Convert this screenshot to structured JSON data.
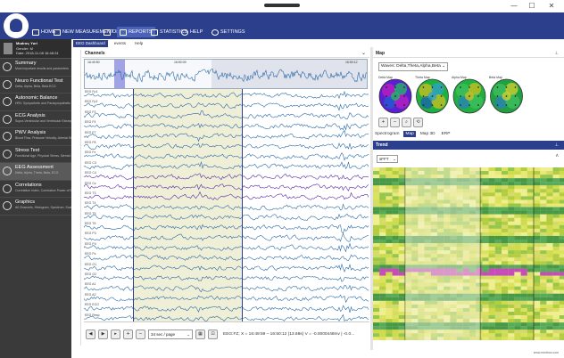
{
  "window": {
    "minimize": "—",
    "maximize": "☐",
    "close": "✕"
  },
  "nav": {
    "home": "HOME",
    "new_measurement": "NEW MEASUREMENT",
    "open": "OPEN",
    "reports": "REPORTS",
    "statistics": "STATISTICS",
    "help": "HELP",
    "settings": "SETTINGS"
  },
  "patient": {
    "name": "Mudrov, Yuri",
    "gender": "Gender: M",
    "age": "Age: 30",
    "date": "Date: 2018-11-08 16:48:24"
  },
  "sidebar": {
    "items": [
      {
        "title": "Summary",
        "sub": "Most important results and parameters"
      },
      {
        "title": "Neuro Functional Test",
        "sub": "Delta, Alpha, Beta, Beta ECG"
      },
      {
        "title": "Autonomic Balance",
        "sub": "HRV, Sympathetic and Parasympathetic Nervous System"
      },
      {
        "title": "ECG Analysis",
        "sub": "Supra-Ventricular and Ventricular Extrasystoles"
      },
      {
        "title": "PWV Analysis",
        "sub": "Blood Flow, Pressure Velocity, Arterial Stiffness, Augmentation"
      },
      {
        "title": "Stress Test",
        "sub": "Functional Age, Physical Stress, Mental Stress"
      },
      {
        "title": "EEG Assessment",
        "sub": "Delta, Alpha, Theta, Beta, ECG"
      },
      {
        "title": "Correlations",
        "sub": "Correlation Index, Correlation Power of ECG and PPG"
      },
      {
        "title": "Graphics",
        "sub": "All Channels, Histogram, Spectrum, Scatterogram"
      }
    ]
  },
  "menu": {
    "tabs": [
      "EEG Dashboard",
      "events",
      "Help"
    ]
  },
  "channels": {
    "title": "Channels",
    "overview_times": [
      "16:49:50",
      "16:50:09",
      "16:50:12"
    ],
    "labels": [
      "EEG Fp1",
      "EEG Fp2",
      "EEG F3",
      "EEG F4",
      "EEG F7",
      "EEG F8",
      "EEG Fz",
      "EEG C3",
      "EEG C4",
      "EEG Cz",
      "EEG T3",
      "EEG T4",
      "EEG T5",
      "EEG T6",
      "EEG P3",
      "EEG P4",
      "EEG Pz",
      "EEG O1",
      "EEG O2",
      "EEG A1",
      "EEG A2",
      "EEG ECG",
      "EEG Resp"
    ]
  },
  "toolbar": {
    "page_size": "34 sec / page",
    "status": "EEG:FZ;   X = 16:49:59 – 16:50:12 (13.68s)   V = -0.0000448mv | -0.0..."
  },
  "map": {
    "title": "Map",
    "waves": "Waves: Delta,Theta,Alpha,Beta",
    "scalps": [
      "Delta Map",
      "Theta Map",
      "Alpha Map",
      "Beta Map"
    ],
    "subtabs": [
      "Spectrogram",
      "Map",
      "Map 3D",
      "ERP"
    ]
  },
  "trend": {
    "title": "Trend",
    "select": "sFFT"
  },
  "footer": {
    "link": "www.medrics.com"
  },
  "colors": {
    "nav": "#2b3f8c",
    "sidebar": "#3a3a3a",
    "eeg_trace": "#2a6aa8",
    "eeg_trace_alt": "#5a2aa8",
    "selection_shade": "#efefd7"
  }
}
